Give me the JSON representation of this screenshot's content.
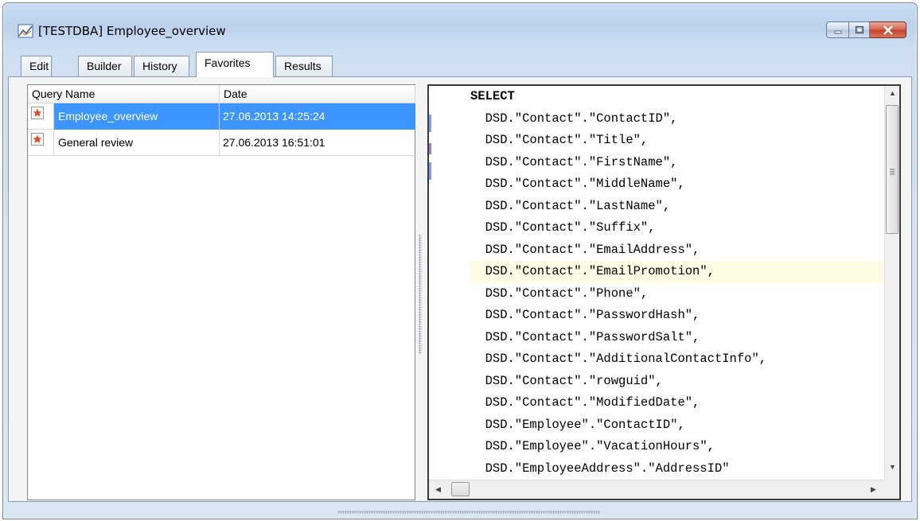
{
  "window": {
    "title": "[TESTDBA] Employee_overview",
    "accent_color": "#3d95ff"
  },
  "tabs": [
    {
      "label": "Edit",
      "active": false
    },
    {
      "label": "Builder",
      "active": false
    },
    {
      "label": "History",
      "active": false
    },
    {
      "label": "Favorites",
      "active": true
    },
    {
      "label": "Results",
      "active": false
    }
  ],
  "favorites": {
    "columns": [
      "Query Name",
      "Date"
    ],
    "rows": [
      {
        "icon": "star-icon",
        "name": "Employee_overview",
        "date": "27.06.2013 14:25:24",
        "selected": true
      },
      {
        "icon": "star-icon",
        "name": "General review",
        "date": "27.06.2013 16:51:01",
        "selected": false
      }
    ]
  },
  "editor": {
    "lines": [
      "SELECT",
      "  DSD.\"Contact\".\"ContactID\",",
      "  DSD.\"Contact\".\"Title\",",
      "  DSD.\"Contact\".\"FirstName\",",
      "  DSD.\"Contact\".\"MiddleName\",",
      "  DSD.\"Contact\".\"LastName\",",
      "  DSD.\"Contact\".\"Suffix\",",
      "  DSD.\"Contact\".\"EmailAddress\",",
      "  DSD.\"Contact\".\"EmailPromotion\",",
      "  DSD.\"Contact\".\"Phone\",",
      "  DSD.\"Contact\".\"PasswordHash\",",
      "  DSD.\"Contact\".\"PasswordSalt\",",
      "  DSD.\"Contact\".\"AdditionalContactInfo\",",
      "  DSD.\"Contact\".\"rowguid\",",
      "  DSD.\"Contact\".\"ModifiedDate\",",
      "  DSD.\"Employee\".\"ContactID\",",
      "  DSD.\"Employee\".\"VacationHours\",",
      "  DSD.\"EmployeeAddress\".\"AddressID\""
    ],
    "current_line_index": 8
  }
}
